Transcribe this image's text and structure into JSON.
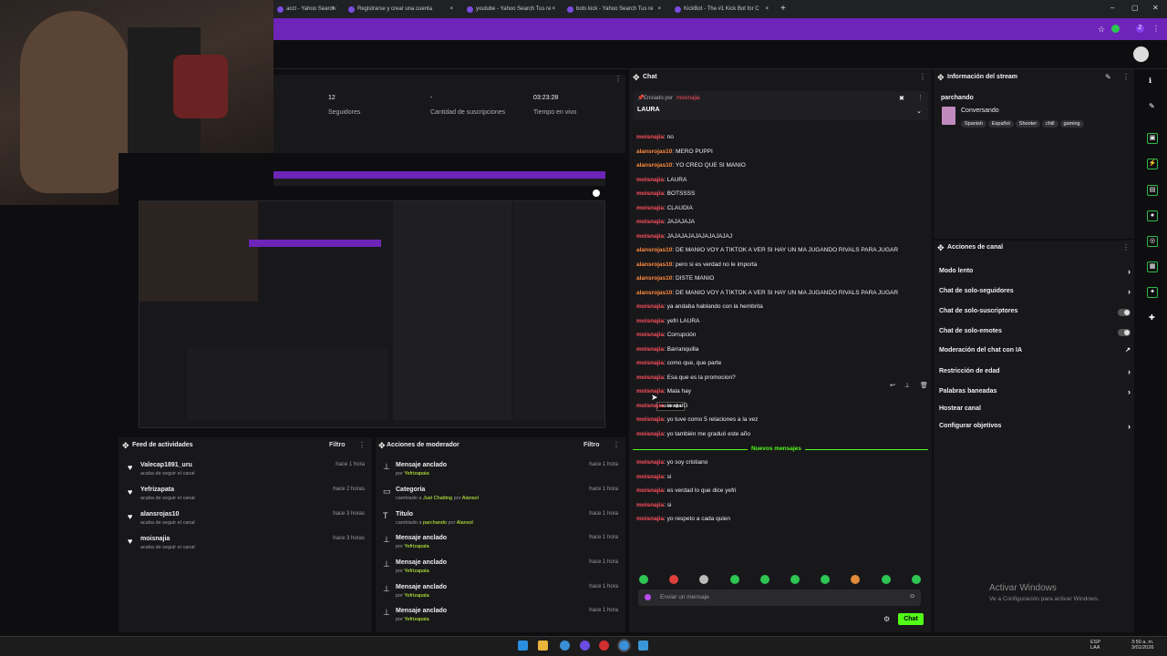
{
  "tabs": [
    {
      "label": "acct - Yahoo Search T"
    },
    {
      "label": "Registrarse y crear una cuenta"
    },
    {
      "label": "youtube - Yahoo Search Tus re"
    },
    {
      "label": "bots kick - Yahoo Search Tus re"
    },
    {
      "label": "KickBot - The #1 Kick Bot for C"
    }
  ],
  "stats": [
    {
      "value": "12",
      "label": "Seguidores"
    },
    {
      "value": "-",
      "label": "Cantidad de suscripciones"
    },
    {
      "value": "03:23:28",
      "label": "Tiempo en vivo"
    }
  ],
  "chat": {
    "title": "Chat",
    "pinned_by": "Enviado por",
    "pinned_user": "moisnajia",
    "pinned_text": "LAURA",
    "new_messages": "Nuevos mensajes",
    "messages": [
      {
        "user": "moisnajia",
        "text": "no",
        "c": "u1"
      },
      {
        "user": "alansrojas10",
        "text": "MERO PUPPI",
        "c": "u2"
      },
      {
        "user": "alansrojas10",
        "text": "YO CREO QUE SI MANIO",
        "c": "u2"
      },
      {
        "user": "moisnajia",
        "text": "LAURA",
        "c": "u1"
      },
      {
        "user": "moisnajia",
        "text": "BOTSSSS",
        "c": "u1"
      },
      {
        "user": "moisnajia",
        "text": "CLAUDIA",
        "c": "u1"
      },
      {
        "user": "moisnajia",
        "text": "JAJAJAJA",
        "c": "u1"
      },
      {
        "user": "moisnajia",
        "text": "JAJAJAJAJAJAJAJAJAJ",
        "c": "u1"
      },
      {
        "user": "alansrojas10",
        "text": "DE MANIO VOY A TIKTOK A VER SI HAY UN MA JUGANDO RIVALS PARA JUGAR",
        "c": "u2"
      },
      {
        "user": "alansrojas10",
        "text": "pero si es verdad no le importa",
        "c": "u2"
      },
      {
        "user": "alansrojas10",
        "text": "DISTE MANIO",
        "c": "u2"
      },
      {
        "user": "alansrojas10",
        "text": "DE MANIO VOY A TIKTOK A VER SI HAY UN MA JUGANDO RIVALS PARA JUGAR",
        "c": "u2"
      },
      {
        "user": "moisnajia",
        "text": "ya andaba hablando con la hembrita",
        "c": "u1"
      },
      {
        "user": "moisnajia",
        "text": "yefri LAURA",
        "c": "u1"
      },
      {
        "user": "moisnajia",
        "text": "Corrupción",
        "c": "u1"
      },
      {
        "user": "moisnajia",
        "text": "Barranquilla",
        "c": "u1"
      },
      {
        "user": "moisnajia",
        "text": "como que, que parte",
        "c": "u1"
      },
      {
        "user": "moisnajia",
        "text": "Esa que es la promocion?",
        "c": "u1"
      },
      {
        "user": "moisnajia",
        "text": "Mala hay",
        "c": "u1"
      },
      {
        "user": "moisnajia",
        "text": "la realG",
        "c": "u1"
      },
      {
        "user": "moisnajia",
        "text": "yo tuve como 5 relaciones a la vez",
        "c": "u1"
      },
      {
        "user": "moisnajia",
        "text": "yo también me graduó este año",
        "c": "u1"
      }
    ],
    "new": [
      {
        "user": "moisnajia",
        "text": "yo soy cristiano",
        "c": "u1"
      },
      {
        "user": "moisnajia",
        "text": "si",
        "c": "u1"
      },
      {
        "user": "moisnajia",
        "text": "es verdad lo que dice yefri",
        "c": "u1"
      },
      {
        "user": "moisnajia",
        "text": "si",
        "c": "u1"
      },
      {
        "user": "moisnajia",
        "text": "yo respeto a cada quien",
        "c": "u1"
      }
    ],
    "tooltip": "moisnajia",
    "input_placeholder": "Enviar un mensaje",
    "send_label": "Chat"
  },
  "stream_info": {
    "title": "Información del stream",
    "stream_title": "parchando",
    "category": "Conversando",
    "tags": [
      "Spanish",
      "Español",
      "Shooter",
      "chill",
      "gaming"
    ]
  },
  "channel_actions": {
    "title": "Acciones de canal",
    "items": [
      {
        "label": "Modo lento",
        "kind": "chevron"
      },
      {
        "label": "Chat de solo-seguidores",
        "kind": "chevron"
      },
      {
        "label": "Chat de solo-suscriptores",
        "kind": "toggle"
      },
      {
        "label": "Chat de solo-emotes",
        "kind": "toggle"
      },
      {
        "label": "Moderación del chat con IA",
        "kind": "link"
      },
      {
        "label": "Restricción de edad",
        "kind": "chevron"
      },
      {
        "label": "Palabras baneadas",
        "kind": "chevron"
      },
      {
        "label": "Hostear canal",
        "kind": "none"
      },
      {
        "label": "Configurar objetivos",
        "kind": "chevron"
      }
    ]
  },
  "activity_feed": {
    "title": "Feed de actividades",
    "filter": "Filtro",
    "items": [
      {
        "name": "Valecap1891_uru",
        "sub": "acaba de seguir el canal",
        "time": "hace 1 hora"
      },
      {
        "name": "Yefrizapata",
        "sub": "acaba de seguir el canal",
        "time": "hace 2 horas"
      },
      {
        "name": "alansrojas10",
        "sub": "acaba de seguir el canal",
        "time": "hace 3 horas"
      },
      {
        "name": "moisnajia",
        "sub": "acaba de seguir el canal",
        "time": "hace 3 horas"
      }
    ]
  },
  "mod_actions": {
    "title": "Acciones de moderador",
    "filter": "Filtro",
    "items": [
      {
        "icon": "pin-icon",
        "name": "Mensaje anclado",
        "sub_pre": "por",
        "sub_hl": "Yefrizapata",
        "sub_mid": "",
        "sub_post": "",
        "time": "hace 1 hora"
      },
      {
        "icon": "category-icon",
        "name": "Categoría",
        "sub_pre": "cambiado a",
        "sub_hl": "Just Chatting",
        "sub_mid": "por",
        "sub_post": "Alansol",
        "time": "hace 1 hora"
      },
      {
        "icon": "title-icon",
        "name": "Título",
        "sub_pre": "cambiado a",
        "sub_hl": "parchando",
        "sub_mid": "por",
        "sub_post": "Alansol",
        "time": "hace 1 hora"
      },
      {
        "icon": "pin-icon",
        "name": "Mensaje anclado",
        "sub_pre": "por",
        "sub_hl": "Yefrizapata",
        "sub_mid": "",
        "sub_post": "",
        "time": "hace 1 hora"
      },
      {
        "icon": "pin-icon",
        "name": "Mensaje anclado",
        "sub_pre": "por",
        "sub_hl": "Yefrizapata",
        "sub_mid": "",
        "sub_post": "",
        "time": "hace 1 hora"
      },
      {
        "icon": "pin-icon",
        "name": "Mensaje anclado",
        "sub_pre": "por",
        "sub_hl": "Yefrizapata",
        "sub_mid": "",
        "sub_post": "",
        "time": "hace 1 hora"
      },
      {
        "icon": "pin-icon",
        "name": "Mensaje anclado",
        "sub_pre": "por",
        "sub_hl": "Yefrizapata",
        "sub_mid": "",
        "sub_post": "",
        "time": "hace 1 hora"
      }
    ]
  },
  "watermark": {
    "line1": "Activar Windows",
    "line2": "Ve a Configuración para activar Windows."
  },
  "taskbar": {
    "lang1": "ESP",
    "lang2": "LAA",
    "time": "3:50 a. m.",
    "date": "3/01/2026"
  },
  "colors": {
    "accent": "#53fc18",
    "brand_bar": "#6e24b8",
    "user_red": "#ff4f5e",
    "user_orange": "#ff8a3d"
  }
}
